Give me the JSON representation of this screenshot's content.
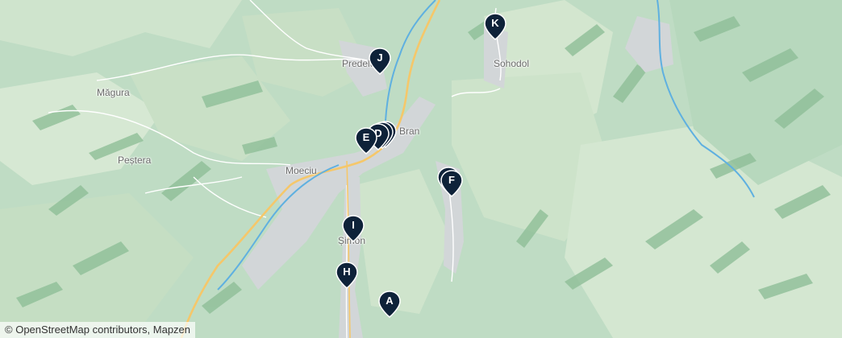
{
  "map": {
    "colors": {
      "land": "#bfdcc4",
      "forest_dark": "#8fbf98",
      "forest_light": "#d6e8d3",
      "urban": "#d2d6d8",
      "river": "#5fb0e0",
      "major_road": "#f5c76a",
      "minor_road": "#ffffff",
      "marker": "#0e2239"
    },
    "places": [
      {
        "id": "magura",
        "name": "Măgura"
      },
      {
        "id": "pestera",
        "name": "Peștera"
      },
      {
        "id": "moeciu",
        "name": "Moeciu"
      },
      {
        "id": "predelut",
        "name": "Predelu"
      },
      {
        "id": "bran",
        "name": "Bran"
      },
      {
        "id": "sohodol",
        "name": "Sohodol"
      },
      {
        "id": "simon",
        "name": "Șimon"
      }
    ],
    "markers": [
      {
        "id": "A",
        "label": "A"
      },
      {
        "id": "D",
        "label": "D"
      },
      {
        "id": "E",
        "label": "E"
      },
      {
        "id": "F",
        "label": "F"
      },
      {
        "id": "H",
        "label": "H"
      },
      {
        "id": "I",
        "label": "I"
      },
      {
        "id": "J",
        "label": "J"
      },
      {
        "id": "K",
        "label": "K"
      }
    ],
    "attribution": {
      "symbol": "©",
      "osm": "OpenStreetMap contributors",
      "separator": ", ",
      "tiles": "Mapzen"
    }
  }
}
